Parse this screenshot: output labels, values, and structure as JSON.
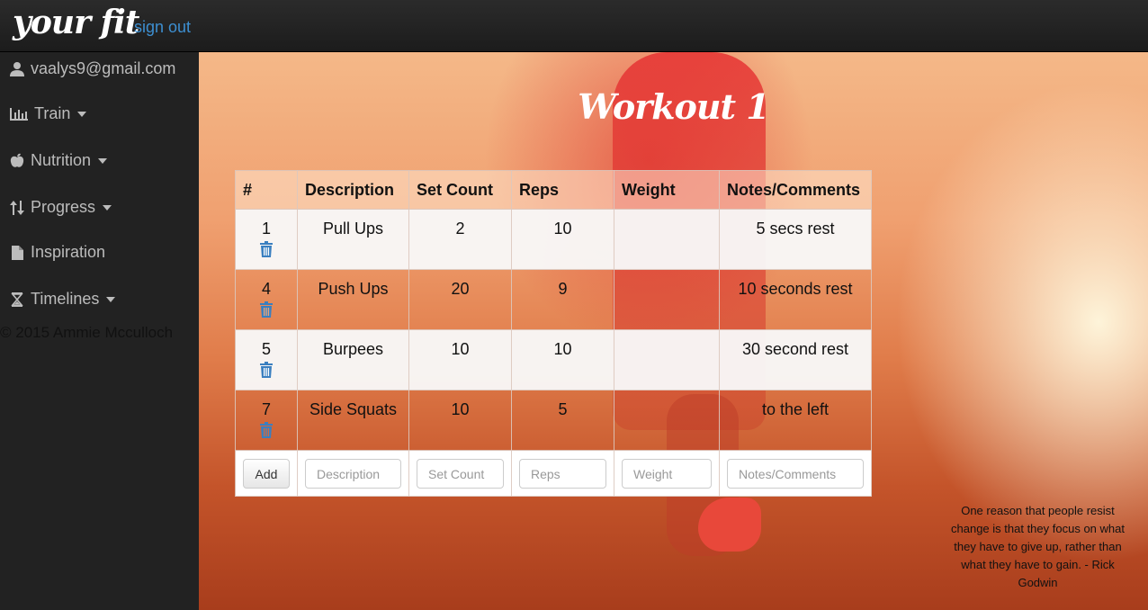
{
  "brand": "your fit",
  "nav": {
    "signout": "sign out"
  },
  "sidebar": {
    "user_email": "vaalys9@gmail.com",
    "items": [
      {
        "label": "Train",
        "icon": "bar-chart-icon"
      },
      {
        "label": "Nutrition",
        "icon": "apple-icon"
      },
      {
        "label": "Progress",
        "icon": "sort-icon"
      },
      {
        "label": "Inspiration",
        "icon": "file-icon"
      },
      {
        "label": "Timelines",
        "icon": "hourglass-icon"
      }
    ],
    "copyright": "© 2015 Ammie Mcculloch"
  },
  "page_title": "Workout 1",
  "table": {
    "headers": [
      "#",
      "Description",
      "Set Count",
      "Reps",
      "Weight",
      "Notes/Comments"
    ],
    "rows": [
      {
        "num": "1",
        "description": "Pull Ups",
        "sets": "2",
        "reps": "10",
        "weight": "",
        "notes": "5 secs rest"
      },
      {
        "num": "4",
        "description": "Push Ups",
        "sets": "20",
        "reps": "9",
        "weight": "",
        "notes": "10 seconds rest"
      },
      {
        "num": "5",
        "description": "Burpees",
        "sets": "10",
        "reps": "10",
        "weight": "",
        "notes": "30 second rest"
      },
      {
        "num": "7",
        "description": "Side Squats",
        "sets": "10",
        "reps": "5",
        "weight": "",
        "notes": "to the left"
      }
    ],
    "add_form": {
      "add_label": "Add",
      "description_placeholder": "Description",
      "sets_placeholder": "Set Count",
      "reps_placeholder": "Reps",
      "weight_placeholder": "Weight",
      "notes_placeholder": "Notes/Comments"
    }
  },
  "quote": "One reason that people resist change is that they focus on what they have to give up, rather than what they have to gain. - Rick Godwin",
  "colors": {
    "link": "#3d8fd1",
    "trash": "#3a7fc0",
    "sidebar_bg": "#222222"
  }
}
